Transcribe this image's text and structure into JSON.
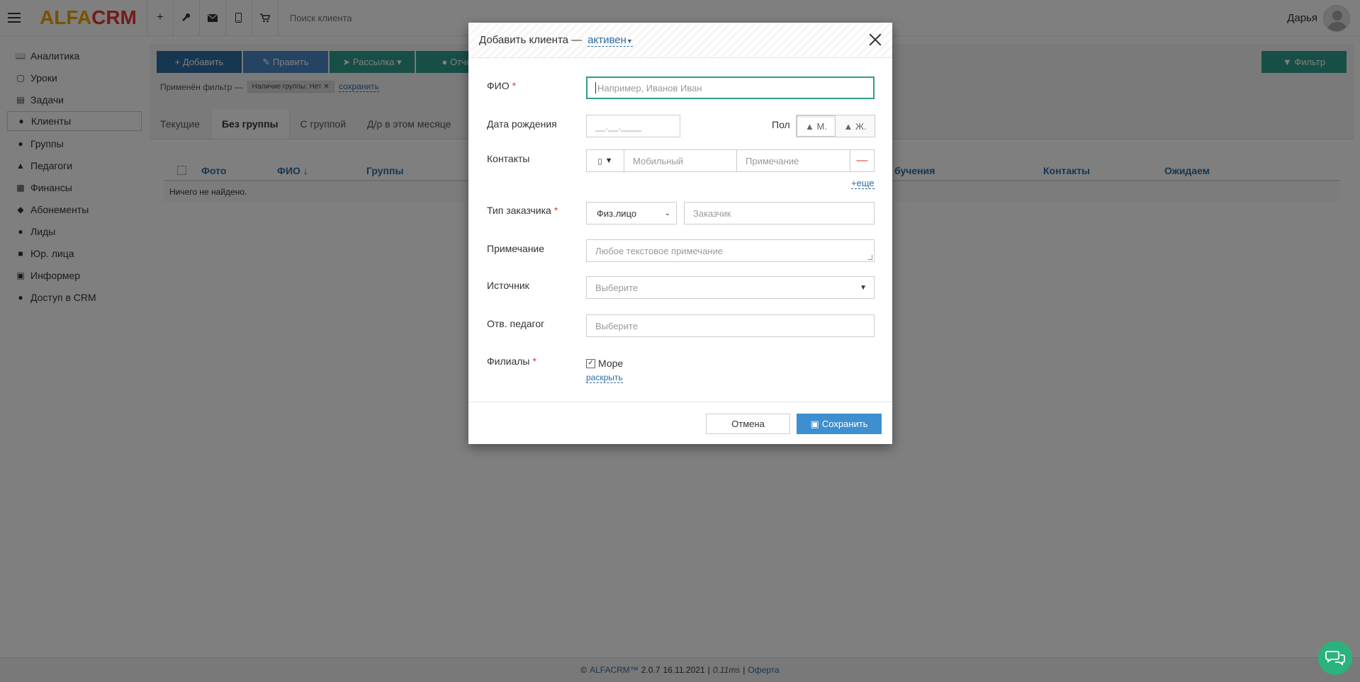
{
  "topbar": {
    "logo_part1": "ALFA",
    "logo_part2": "CRM",
    "icons": [
      "plus-icon",
      "wrench-icon",
      "envelope-icon",
      "phone-icon",
      "cart-icon"
    ],
    "search_placeholder": "Поиск клиента",
    "user_name": "Дарья"
  },
  "sidebar": {
    "items": [
      {
        "label": "Аналитика",
        "icon": "book-icon"
      },
      {
        "label": "Уроки",
        "icon": "calendar-icon"
      },
      {
        "label": "Задачи",
        "icon": "tasks-icon"
      },
      {
        "label": "Клиенты",
        "icon": "user-icon"
      },
      {
        "label": "Группы",
        "icon": "users-icon"
      },
      {
        "label": "Педагоги",
        "icon": "graduation-cap-icon"
      },
      {
        "label": "Финансы",
        "icon": "money-icon"
      },
      {
        "label": "Абонементы",
        "icon": "tag-icon"
      },
      {
        "label": "Лиды",
        "icon": "user-plus-icon"
      },
      {
        "label": "Юр. лица",
        "icon": "briefcase-icon"
      },
      {
        "label": "Информер",
        "icon": "file-icon"
      },
      {
        "label": "Доступ в CRM",
        "icon": "lock-icon"
      }
    ]
  },
  "toolbar": {
    "add_label": "Добавить",
    "edit_label": "Править",
    "mailing_label": "Рассылка",
    "reports_label": "Отчет",
    "filter_label": "Фильтр"
  },
  "filter": {
    "applied_label": "Применён фильтр —",
    "tag": "Наличие группы: Нет",
    "save_label": "сохранить"
  },
  "tabs": [
    "Текущие",
    "Без группы",
    "С группой",
    "Д/р в этом месяце"
  ],
  "table": {
    "headers": [
      "Фото",
      "ФИО ↓",
      "Группы",
      "бучения",
      "Контакты",
      "Ожидаем"
    ],
    "empty_text": "Ничего не найдено."
  },
  "footer": {
    "copyright": "©",
    "brand": "ALFACRM™",
    "version": "2.0.7",
    "date": "16.11.2021",
    "timing": "0.11ms",
    "offer": "Оферта"
  },
  "modal": {
    "title": "Добавить клиента —",
    "status": "активен",
    "fio_label": "ФИО",
    "fio_placeholder": "Например, Иванов Иван",
    "birth_label": "Дата рождения",
    "birth_placeholder": "__.__.____",
    "gender_label": "Пол",
    "gender_m": "М.",
    "gender_f": "Ж.",
    "contacts_label": "Контакты",
    "mobile_placeholder": "Мобильный",
    "note_short_placeholder": "Примечание",
    "more_label": "+еще",
    "customer_type_label": "Тип заказчика",
    "customer_type_value": "Физ.лицо",
    "customer_placeholder": "Заказчик",
    "note_label": "Примечание",
    "note_placeholder": "Любое текстовое примечание",
    "source_label": "Источник",
    "source_placeholder": "Выберите",
    "teacher_label": "Отв. педагог",
    "teacher_placeholder": "Выберите",
    "branches_label": "Филиалы",
    "branch_option": "Море",
    "expand_label": "раскрыть",
    "cancel_label": "Отмена",
    "save_label": "Сохранить",
    "required_mark": "*"
  }
}
